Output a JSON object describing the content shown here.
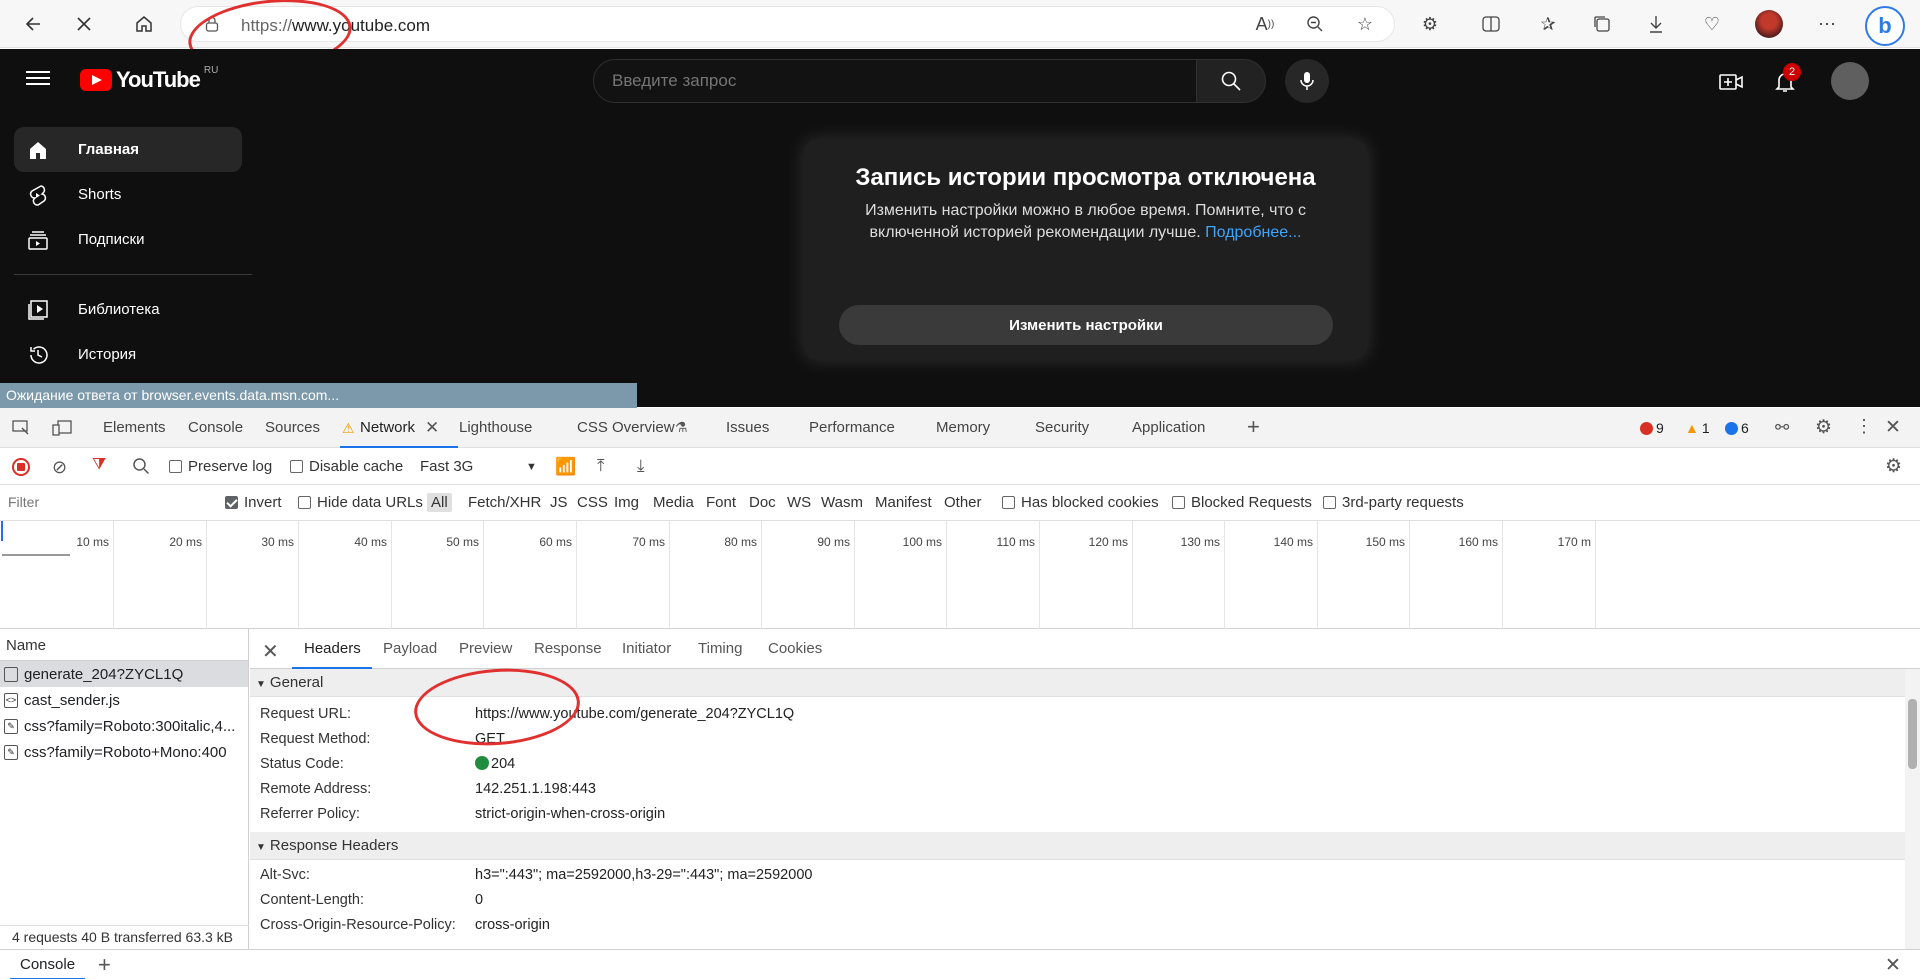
{
  "browser": {
    "url_prefix": "https://",
    "url_host": "www.youtube.com"
  },
  "youtube": {
    "logo_text": "YouTube",
    "region": "RU",
    "search_placeholder": "Введите запрос",
    "notification_count": "2",
    "sidebar": [
      {
        "label": "Главная",
        "icon": "home-icon"
      },
      {
        "label": "Shorts",
        "icon": "shorts-icon"
      },
      {
        "label": "Подписки",
        "icon": "subscriptions-icon"
      },
      {
        "label": "Библиотека",
        "icon": "library-icon"
      },
      {
        "label": "История",
        "icon": "history-icon"
      }
    ],
    "card": {
      "title": "Запись истории просмотра отключена",
      "text": "Изменить настройки можно в любое время. Помните, что с включенной историей рекомендации лучше.",
      "link": "Подробнее...",
      "button": "Изменить настройки"
    },
    "status_text": "Ожидание ответа от browser.events.data.msn.com..."
  },
  "devtools": {
    "tabs": [
      "Elements",
      "Console",
      "Sources",
      "Network",
      "Lighthouse",
      "CSS Overview",
      "Issues",
      "Performance",
      "Memory",
      "Security",
      "Application"
    ],
    "counts": {
      "errors": "9",
      "warnings": "1",
      "info": "6"
    },
    "toolbar": {
      "preserve_log": "Preserve log",
      "disable_cache": "Disable cache",
      "throttling": "Fast 3G"
    },
    "filter": {
      "placeholder": "Filter",
      "invert": "Invert",
      "hide_data_urls": "Hide data URLs",
      "types": [
        "All",
        "Fetch/XHR",
        "JS",
        "CSS",
        "Img",
        "Media",
        "Font",
        "Doc",
        "WS",
        "Wasm",
        "Manifest",
        "Other"
      ],
      "has_blocked_cookies": "Has blocked cookies",
      "blocked_requests": "Blocked Requests",
      "third_party": "3rd-party requests"
    },
    "timeline_ticks": [
      "10 ms",
      "20 ms",
      "30 ms",
      "40 ms",
      "50 ms",
      "60 ms",
      "70 ms",
      "80 ms",
      "90 ms",
      "100 ms",
      "110 ms",
      "120 ms",
      "130 ms",
      "140 ms",
      "150 ms",
      "160 ms",
      "170 m"
    ],
    "requests": {
      "header": "Name",
      "rows": [
        "generate_204?ZYCL1Q",
        "cast_sender.js",
        "css?family=Roboto:300italic,4...",
        "css?family=Roboto+Mono:400"
      ],
      "footer": "4 requests  40 B transferred  63.3 kB"
    },
    "detail": {
      "tabs": [
        "Headers",
        "Payload",
        "Preview",
        "Response",
        "Initiator",
        "Timing",
        "Cookies"
      ],
      "general_title": "General",
      "general": [
        {
          "k": "Request URL:",
          "v": "https://www.youtube.com/generate_204?ZYCL1Q"
        },
        {
          "k": "Request Method:",
          "v": "GET"
        },
        {
          "k": "Status Code:",
          "v": "204"
        },
        {
          "k": "Remote Address:",
          "v": "142.251.1.198:443"
        },
        {
          "k": "Referrer Policy:",
          "v": "strict-origin-when-cross-origin"
        }
      ],
      "response_title": "Response Headers",
      "response": [
        {
          "k": "Alt-Svc:",
          "v": "h3=\":443\"; ma=2592000,h3-29=\":443\"; ma=2592000"
        },
        {
          "k": "Content-Length:",
          "v": "0"
        },
        {
          "k": "Cross-Origin-Resource-Policy:",
          "v": "cross-origin"
        }
      ]
    },
    "drawer_tab": "Console"
  },
  "colors": {
    "annotation": "#e03030",
    "accent": "#1a73e8",
    "yt_red": "#ff0000"
  }
}
